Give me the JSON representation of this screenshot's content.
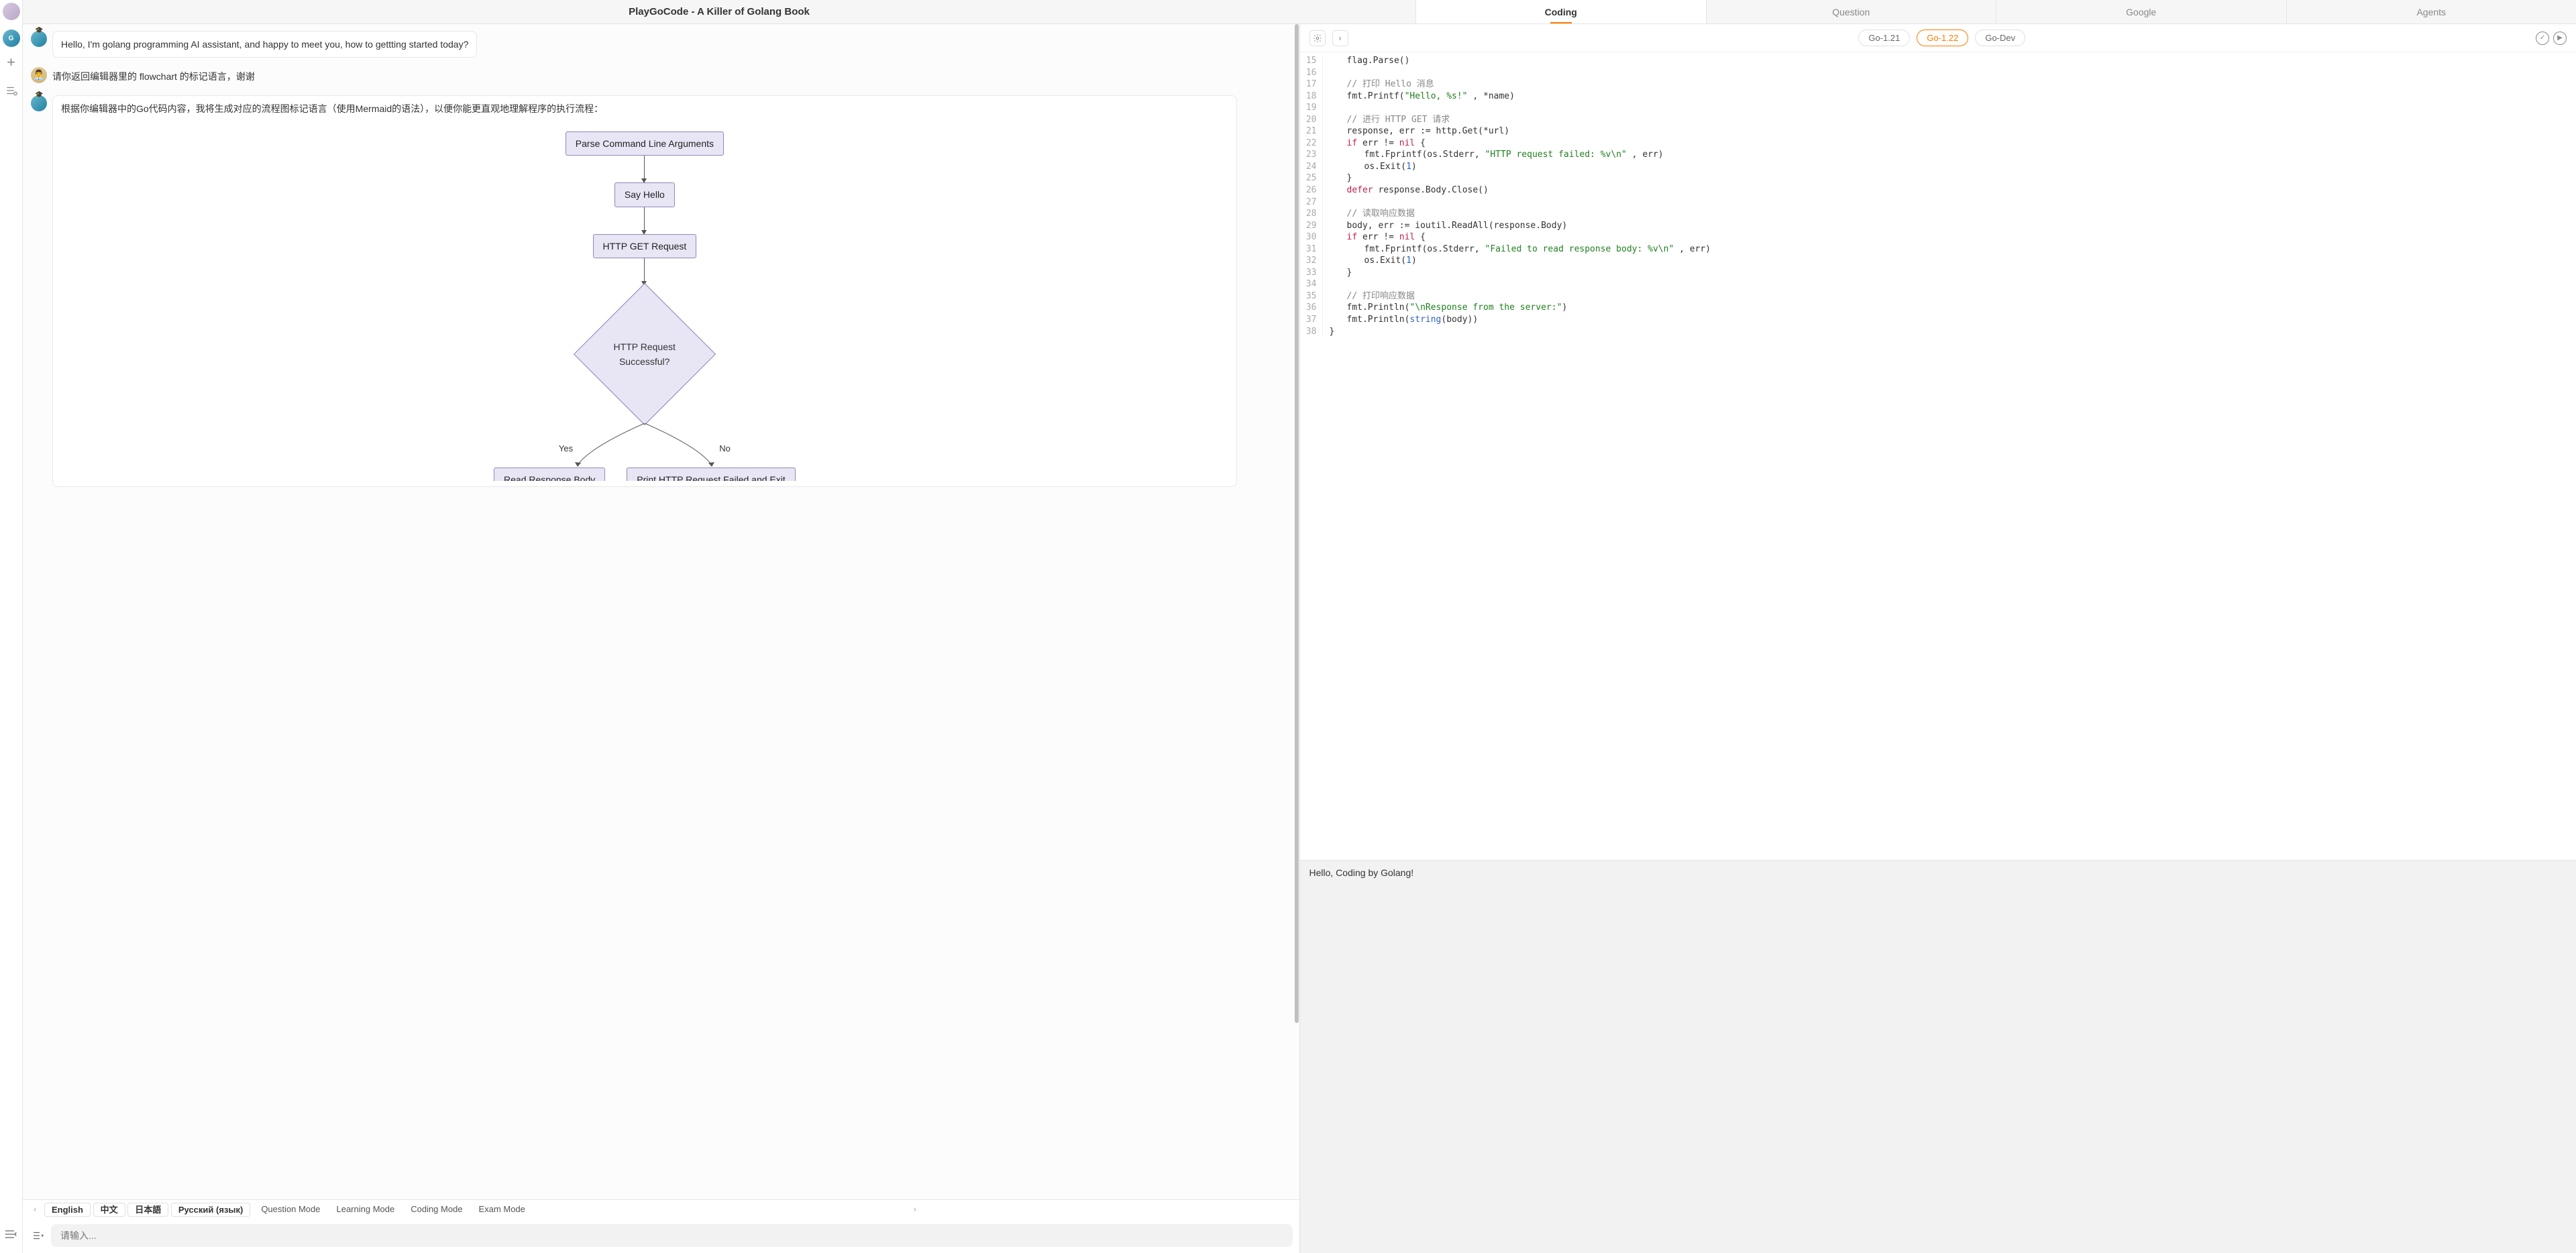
{
  "app_title": "PlayGoCode - A Killer of Golang Book",
  "top_tabs": [
    {
      "label": "Coding",
      "active": true
    },
    {
      "label": "Question",
      "active": false
    },
    {
      "label": "Google",
      "active": false
    },
    {
      "label": "Agents",
      "active": false
    }
  ],
  "toolbar": {
    "ai_logo_text": "G"
  },
  "chat": {
    "messages": [
      {
        "role": "assistant",
        "text": "Hello, I'm golang programming AI assistant, and happy to meet you, how to gettting started today?"
      },
      {
        "role": "user",
        "text": "请你返回编辑器里的 flowchart 的标记语言，谢谢"
      },
      {
        "role": "assistant",
        "text": "根据你编辑器中的Go代码内容，我将生成对应的流程图标记语言（使用Mermaid的语法），以便你能更直观地理解程序的执行流程："
      }
    ],
    "flowchart": {
      "n1": "Parse Command Line Arguments",
      "n2": "Say Hello",
      "n3": "HTTP GET Request",
      "n4": "HTTP Request Successful?",
      "yes": "Yes",
      "no": "No",
      "n5": "Read Response Body",
      "n6": "Print HTTP Request Failed and Exit"
    }
  },
  "langbar": {
    "langs": [
      "English",
      "中文",
      "日本語",
      "Русский (язык)"
    ],
    "modes": [
      "Question Mode",
      "Learning Mode",
      "Coding Mode",
      "Exam Mode"
    ]
  },
  "input": {
    "placeholder": "请输入..."
  },
  "editor": {
    "versions": [
      {
        "label": "Go-1.21",
        "active": false
      },
      {
        "label": "Go-1.22",
        "active": true
      },
      {
        "label": "Go-Dev",
        "active": false
      }
    ],
    "lines": [
      {
        "n": 15,
        "ind": 1,
        "frag": [
          [
            "",
            "flag.Parse()"
          ]
        ]
      },
      {
        "n": 16,
        "ind": 1,
        "frag": []
      },
      {
        "n": 17,
        "ind": 1,
        "frag": [
          [
            "c-com",
            "// 打印 Hello 消息"
          ]
        ]
      },
      {
        "n": 18,
        "ind": 1,
        "frag": [
          [
            "",
            "fmt.Printf("
          ],
          [
            "c-str",
            "\"Hello, %s!\""
          ],
          [
            "",
            " , *name)"
          ]
        ]
      },
      {
        "n": 19,
        "ind": 1,
        "frag": []
      },
      {
        "n": 20,
        "ind": 1,
        "frag": [
          [
            "c-com",
            "// 进行 HTTP GET 请求"
          ]
        ]
      },
      {
        "n": 21,
        "ind": 1,
        "frag": [
          [
            "",
            "response, err := http.Get(*url)"
          ]
        ]
      },
      {
        "n": 22,
        "ind": 1,
        "frag": [
          [
            "c-kw",
            "if"
          ],
          [
            "",
            " err != "
          ],
          [
            "c-kw",
            "nil"
          ],
          [
            "",
            " {"
          ]
        ]
      },
      {
        "n": 23,
        "ind": 2,
        "frag": [
          [
            "",
            "fmt.Fprintf(os.Stderr, "
          ],
          [
            "c-str",
            "\"HTTP request failed: %v\\n\""
          ],
          [
            "",
            " , err)"
          ]
        ]
      },
      {
        "n": 24,
        "ind": 2,
        "frag": [
          [
            "",
            "os.Exit("
          ],
          [
            "c-num",
            "1"
          ],
          [
            "",
            ")"
          ]
        ]
      },
      {
        "n": 25,
        "ind": 1,
        "frag": [
          [
            "",
            "}"
          ]
        ]
      },
      {
        "n": 26,
        "ind": 1,
        "frag": [
          [
            "c-kw",
            "defer"
          ],
          [
            "",
            " response.Body.Close()"
          ]
        ]
      },
      {
        "n": 27,
        "ind": 1,
        "frag": []
      },
      {
        "n": 28,
        "ind": 1,
        "frag": [
          [
            "c-com",
            "// 读取响应数据"
          ]
        ]
      },
      {
        "n": 29,
        "ind": 1,
        "frag": [
          [
            "",
            "body, err := ioutil.ReadAll(response.Body)"
          ]
        ]
      },
      {
        "n": 30,
        "ind": 1,
        "frag": [
          [
            "c-kw",
            "if"
          ],
          [
            "",
            " err != "
          ],
          [
            "c-kw",
            "nil"
          ],
          [
            "",
            " {"
          ]
        ]
      },
      {
        "n": 31,
        "ind": 2,
        "frag": [
          [
            "",
            "fmt.Fprintf(os.Stderr, "
          ],
          [
            "c-str",
            "\"Failed to read response body: %v\\n\""
          ],
          [
            "",
            " , err)"
          ]
        ]
      },
      {
        "n": 32,
        "ind": 2,
        "frag": [
          [
            "",
            "os.Exit("
          ],
          [
            "c-num",
            "1"
          ],
          [
            "",
            ")"
          ]
        ]
      },
      {
        "n": 33,
        "ind": 1,
        "frag": [
          [
            "",
            "}"
          ]
        ]
      },
      {
        "n": 34,
        "ind": 1,
        "frag": []
      },
      {
        "n": 35,
        "ind": 1,
        "frag": [
          [
            "c-com",
            "// 打印响应数据"
          ]
        ]
      },
      {
        "n": 36,
        "ind": 1,
        "frag": [
          [
            "",
            "fmt.Println("
          ],
          [
            "c-str",
            "\"\\nResponse from the server:\""
          ],
          [
            "",
            ")"
          ]
        ]
      },
      {
        "n": 37,
        "ind": 1,
        "frag": [
          [
            "",
            "fmt.Println("
          ],
          [
            "c-fn",
            "string"
          ],
          [
            "",
            "(body))"
          ]
        ]
      },
      {
        "n": 38,
        "ind": 0,
        "frag": [
          [
            "",
            "}"
          ]
        ]
      }
    ]
  },
  "output": {
    "text": "Hello, Coding by Golang!"
  }
}
